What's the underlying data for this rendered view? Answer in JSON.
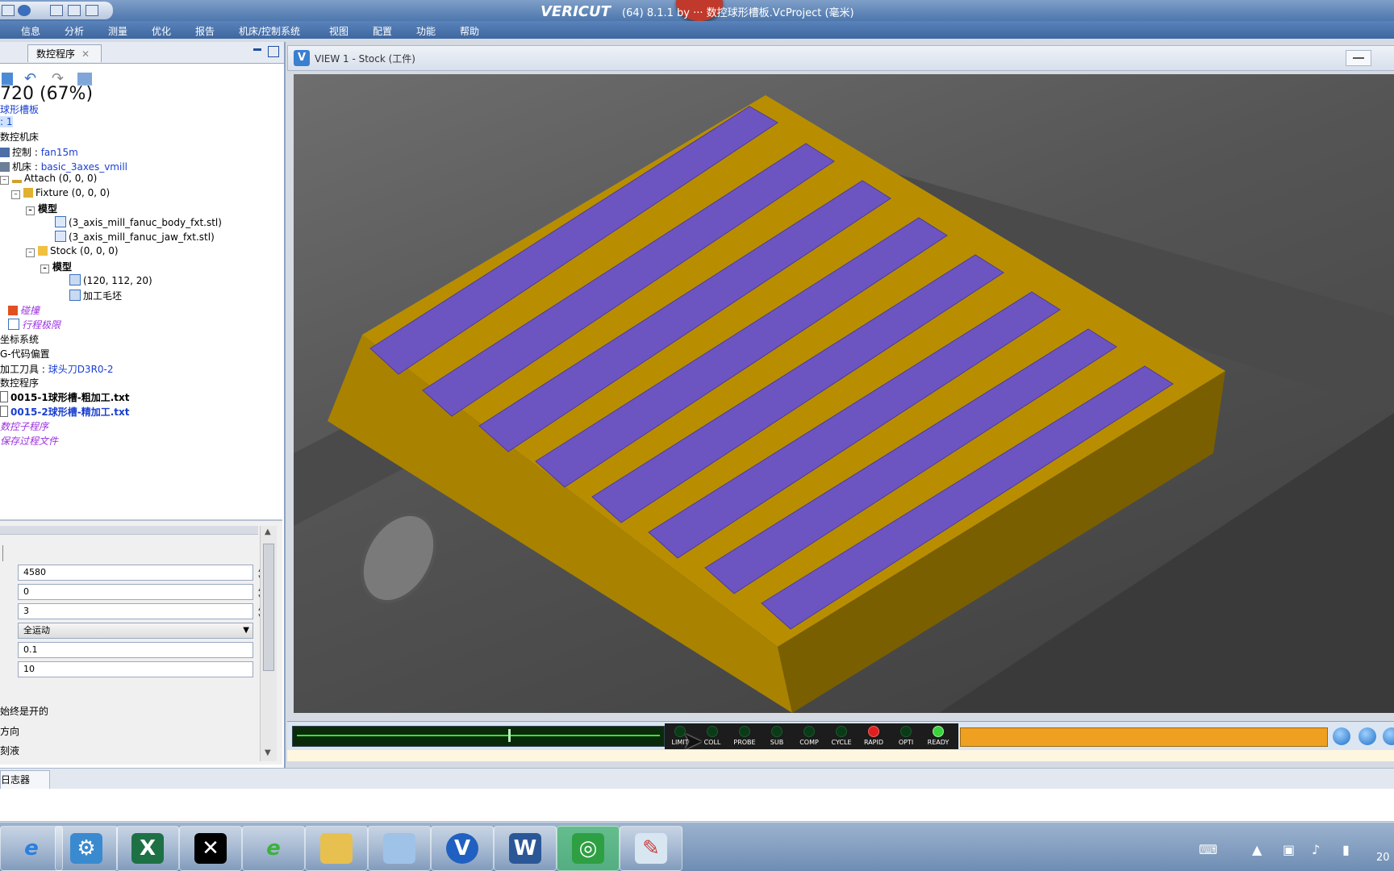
{
  "window": {
    "logo": "VERICUT",
    "title": "(64)  8.1.1 by ··· 数控球形槽板.VcProject (毫米)"
  },
  "menu": [
    "信息",
    "分析",
    "测量",
    "优化",
    "报告",
    "机床/控制系统",
    "视图",
    "配置",
    "功能",
    "帮助"
  ],
  "left_tab": {
    "label": "数控程序"
  },
  "zoom_overlay": "720 (67%)",
  "tree": {
    "root": "球形槽板",
    "setup": ": 1",
    "machine": "数控机床",
    "control_label": "控制 : ",
    "control_value": "fan15m",
    "machine_label": "机床 : ",
    "machine_value": "basic_3axes_vmill",
    "attach": "Attach (0, 0, 0)",
    "fixture": "Fixture (0, 0, 0)",
    "model1": "模型",
    "body_stl": "(3_axis_mill_fanuc_body_fxt.stl)",
    "jaw_stl": "(3_axis_mill_fanuc_jaw_fxt.stl)",
    "stock": "Stock (0, 0, 0)",
    "model2": "模型",
    "block": "(120, 112, 20)",
    "blank": "加工毛坯",
    "collision": "碰撞",
    "travel": "行程极限",
    "coords": "坐标系统",
    "gcode_offsets": "G-代码偏置",
    "tool_label": "加工刀具 : ",
    "tool_value": "球头刀D3R0-2",
    "programs": "数控程序",
    "prog1": "0015-1球形槽-粗加工.txt",
    "prog2": "0015-2球形槽-精加工.txt",
    "subprog": "数控子程序",
    "saved": "保存过程文件"
  },
  "props": {
    "v1": "4580",
    "v2": "0",
    "v3": "3",
    "select": "全运动",
    "v4": "0.1",
    "v5": "10",
    "label1": "始终是开的",
    "label2": "方向",
    "label3": "刻液"
  },
  "view": {
    "title": "VIEW 1 - Stock (工件)"
  },
  "leds": [
    "LIMIT",
    "COLL",
    "PROBE",
    "SUB",
    "COMP",
    "CYCLE",
    "RAPID",
    "OPTI",
    "READY"
  ],
  "led_colors": {
    "off": "#0b3a18",
    "rapid": "#e02020",
    "ready": "#3bd23b"
  },
  "log_tab": "日志器",
  "colors": {
    "stock_yellow": "#c89a00",
    "groove_purple": "#6a52b8",
    "accent": "#3e67a0"
  },
  "taskbar": [
    "ie-icon",
    "search-app-icon",
    "excel-icon",
    "capcut-icon",
    "ie-green-icon",
    "folder-icon",
    "notepad-icon",
    "vericut-icon",
    "word-icon",
    "wechat-icon",
    "paint-icon"
  ],
  "clock": "20"
}
